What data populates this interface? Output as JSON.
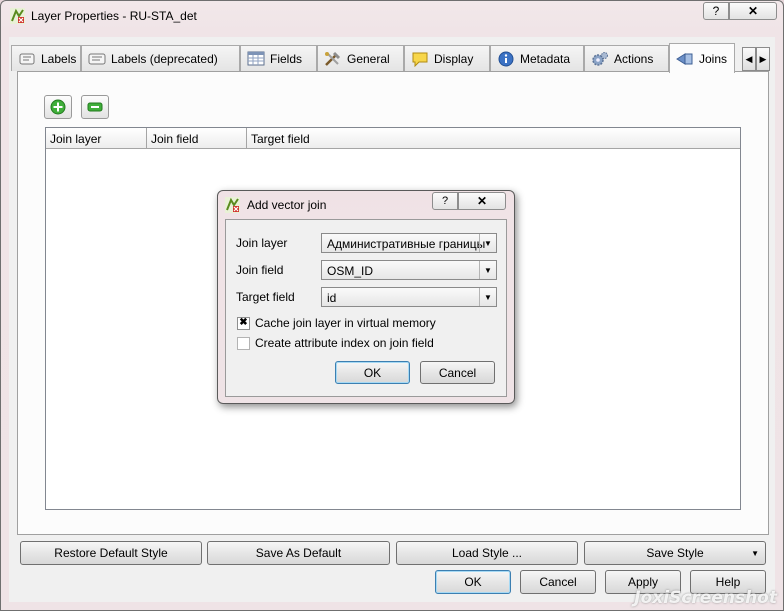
{
  "window": {
    "title": "Layer Properties - RU-STA_det",
    "help_label": "?",
    "close_label": "✕"
  },
  "tabs": [
    {
      "label": "Labels",
      "icon": "labels-icon"
    },
    {
      "label": "Labels (deprecated)",
      "icon": "labels-deprecated-icon"
    },
    {
      "label": "Fields",
      "icon": "fields-table-icon"
    },
    {
      "label": "General",
      "icon": "tools-icon"
    },
    {
      "label": "Display",
      "icon": "speech-bubble-icon"
    },
    {
      "label": "Metadata",
      "icon": "info-icon"
    },
    {
      "label": "Actions",
      "icon": "gears-icon"
    },
    {
      "label": "Joins",
      "icon": "joins-icon",
      "active": true
    }
  ],
  "joins_table": {
    "columns": [
      "Join layer",
      "Join field",
      "Target field"
    ]
  },
  "dialog": {
    "title": "Add vector join",
    "help_label": "?",
    "close_label": "✕",
    "join_layer_label": "Join layer",
    "join_layer_value": "Административные границы",
    "join_field_label": "Join field",
    "join_field_value": "OSM_ID",
    "target_field_label": "Target field",
    "target_field_value": "id",
    "cache_label": "Cache join layer in virtual memory",
    "cache_checked": true,
    "index_label": "Create attribute index on join field",
    "index_checked": false,
    "ok_label": "OK",
    "cancel_label": "Cancel"
  },
  "style_buttons": {
    "restore": "Restore Default Style",
    "save_default": "Save As Default",
    "load": "Load Style ...",
    "save": "Save Style"
  },
  "footer": {
    "ok": "OK",
    "cancel": "Cancel",
    "apply": "Apply",
    "help": "Help"
  },
  "watermark": "JoxiScreenshot"
}
